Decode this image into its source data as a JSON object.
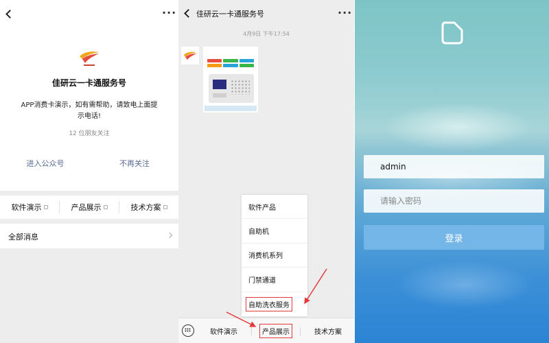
{
  "profile": {
    "account_name": "佳研云一卡通服务号",
    "description": "APP消费卡演示，如有需帮助，请致电上面提示电话!",
    "friends_follow": "12 位朋友关注",
    "enter_button": "进入公众号",
    "unfollow_button": "不再关注",
    "menu": [
      "软件演示",
      "产品展示",
      "技术方案"
    ],
    "all_messages": "全部消息",
    "accent_color": "#576b95"
  },
  "chat": {
    "title": "佳研云一卡通服务号",
    "timestamp": "4月9日 下午17:54",
    "popup_items": [
      "软件产品",
      "自助机",
      "消费机系列",
      "门禁通道",
      "自助洗衣服务"
    ],
    "tabs": [
      "软件演示",
      "产品展示",
      "技术方案"
    ],
    "highlight_color": "#e4393c",
    "card_colors": [
      "#e94b3c",
      "#3ab54a",
      "#27a2db",
      "#f39c12",
      "#27a2db",
      "#3ab54a"
    ]
  },
  "login": {
    "username_value": "admin",
    "password_placeholder": "请输入密码",
    "login_button": "登录",
    "button_color": "#74b6e8"
  },
  "icons": {
    "back": "back-chevron-icon",
    "more": "more-dots-icon",
    "keyboard": "keyboard-icon",
    "menu": "menu-glyph-icon",
    "app_logo": "app-logo-icon"
  }
}
